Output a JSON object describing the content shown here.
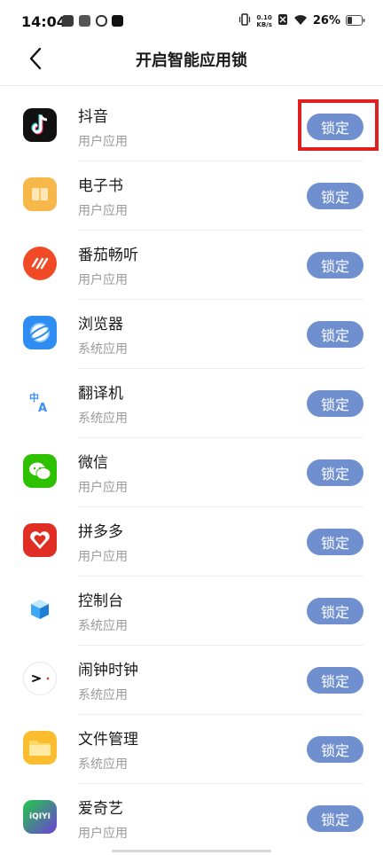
{
  "status_bar": {
    "time": "14:04",
    "net_speed_value": "0.10",
    "net_speed_unit": "KB/s",
    "battery": "26%"
  },
  "header": {
    "title": "开启智能应用锁"
  },
  "apps": [
    {
      "name": "抖音",
      "type": "用户应用",
      "button": "锁定",
      "icon": "douyin-icon"
    },
    {
      "name": "电子书",
      "type": "用户应用",
      "button": "锁定",
      "icon": "ebook-icon"
    },
    {
      "name": "番茄畅听",
      "type": "用户应用",
      "button": "锁定",
      "icon": "fanqie-listen-icon"
    },
    {
      "name": "浏览器",
      "type": "系统应用",
      "button": "锁定",
      "icon": "browser-icon"
    },
    {
      "name": "翻译机",
      "type": "系统应用",
      "button": "锁定",
      "icon": "translator-icon"
    },
    {
      "name": "微信",
      "type": "用户应用",
      "button": "锁定",
      "icon": "wechat-icon"
    },
    {
      "name": "拼多多",
      "type": "用户应用",
      "button": "锁定",
      "icon": "pinduoduo-icon"
    },
    {
      "name": "控制台",
      "type": "系统应用",
      "button": "锁定",
      "icon": "console-icon"
    },
    {
      "name": "闹钟时钟",
      "type": "系统应用",
      "button": "锁定",
      "icon": "clock-icon"
    },
    {
      "name": "文件管理",
      "type": "系统应用",
      "button": "锁定",
      "icon": "file-manager-icon"
    },
    {
      "name": "爱奇艺",
      "type": "用户应用",
      "button": "锁定",
      "icon": "iqiyi-icon",
      "icon_text": "iQIYI"
    }
  ],
  "highlight_color": "#e0201e",
  "accent_color": "#6f8fce"
}
